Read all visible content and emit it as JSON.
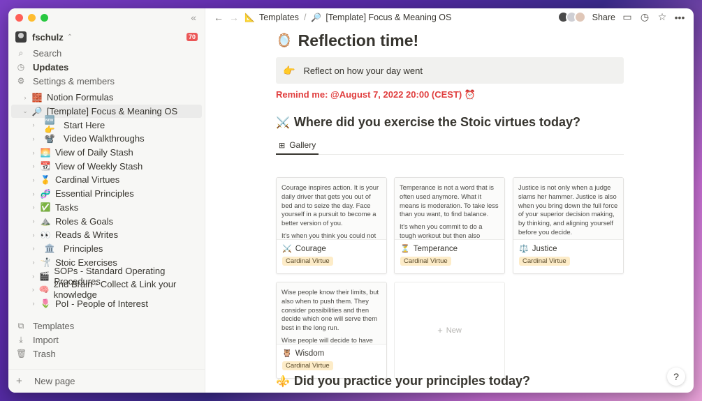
{
  "sidebar": {
    "workspace_name": "fschulz",
    "notification_count": "70",
    "nav": [
      {
        "icon": "search-icon",
        "glyph": "⌕",
        "label": "Search"
      },
      {
        "icon": "clock-icon",
        "glyph": "◷",
        "label": "Updates"
      },
      {
        "icon": "gear-icon",
        "glyph": "⚙",
        "label": "Settings & members"
      }
    ],
    "tree": [
      {
        "label": "Notion Formulas",
        "icon": "🧱",
        "indent": 0
      },
      {
        "label": "[Template] Focus & Meaning OS",
        "icon": "🔎",
        "indent": 0,
        "expanded": true,
        "selected": true
      },
      {
        "label": "Start Here",
        "icon": "🆕👉",
        "indent": 1
      },
      {
        "label": "Video Walkthroughs",
        "icon": "📽️",
        "indent": 1
      },
      {
        "label": "View of Daily Stash",
        "icon": "🌅",
        "indent": 1
      },
      {
        "label": "View of Weekly Stash",
        "icon": "📆",
        "indent": 1
      },
      {
        "label": "Cardinal Virtues",
        "icon": "🥇",
        "indent": 1
      },
      {
        "label": "Essential Principles",
        "icon": "🧬",
        "indent": 1
      },
      {
        "label": "Tasks",
        "icon": "✅",
        "indent": 1
      },
      {
        "label": "Roles & Goals",
        "icon": "⛰️",
        "indent": 1
      },
      {
        "label": "Reads & Writes",
        "icon": "👀",
        "indent": 1
      },
      {
        "label": "Principles",
        "icon": "🏛️",
        "indent": 1
      },
      {
        "label": "Stoic Exercises",
        "icon": "🤺",
        "indent": 1
      },
      {
        "label": "SOPs - Standard Operating Procedures",
        "icon": "🎬",
        "indent": 1
      },
      {
        "label": "2nd Brain - Collect & Link your knowledge",
        "icon": "🧠",
        "indent": 1
      },
      {
        "label": "PoI - People of Interest",
        "icon": "🌷",
        "indent": 1
      }
    ],
    "bottom_nav": [
      {
        "icon": "templates-icon",
        "glyph": "⧉",
        "label": "Templates"
      },
      {
        "icon": "import-icon",
        "glyph": "⤓",
        "label": "Import"
      },
      {
        "icon": "trash-icon",
        "glyph": "🗑",
        "label": "Trash"
      }
    ],
    "new_page": "New page"
  },
  "topbar": {
    "breadcrumb": [
      {
        "icon": "📐",
        "label": "Templates"
      },
      {
        "icon": "🔎",
        "label": "[Template] Focus & Meaning OS"
      }
    ],
    "separator": "/",
    "share_label": "Share",
    "avatar_colors": [
      "#4a4a4a",
      "#cfcfd4",
      "#e0c7b8"
    ]
  },
  "page": {
    "title_emoji": "🪞",
    "title": "Reflection time!",
    "callout_emoji": "👉",
    "callout_text": "Reflect on how your day went",
    "remind_label": "Remind me: ",
    "remind_time": "@August 7, 2022 20:00 (CEST)",
    "remind_emoji": "⏰",
    "section1_emoji": "⚔️",
    "section1_title": "Where did you exercise the Stoic virtues today?",
    "tab_label": "Gallery",
    "section2_emoji": "⚜️",
    "section2_title": "Did you practice your principles today?",
    "new_label": "New"
  },
  "cards": [
    {
      "title": "Courage",
      "emoji": "⚔️",
      "tag": "Cardinal Virtue",
      "p1": "Courage inspires action. It is your daily driver that gets you out of bed and to seize the day. Face yourself in a pursuit to become a better version of you.",
      "p2": "It's when you think you could not"
    },
    {
      "title": "Temperance",
      "emoji": "⏳",
      "tag": "Cardinal Virtue",
      "p1": "Temperance is not a word that is often used anymore. What it means is moderation. To take less than you want, to find balance.",
      "p2": "It's when you commit to do a tough workout but then also commit in the"
    },
    {
      "title": "Justice",
      "emoji": "⚖️",
      "tag": "Cardinal Virtue",
      "p1": "Justice is not only when a judge slams her hammer. Justice is also when you bring down the full force of your superior decision making, by thinking, and aligning yourself before you decide.",
      "p2": ""
    },
    {
      "title": "Wisdom",
      "emoji": "🦉",
      "tag": "Cardinal Virtue",
      "p1": "Wise people know their limits, but also when to push them. They consider possibilities and then decide which one will serve them best in the long run.",
      "p2": "Wise people will decide to have the"
    }
  ],
  "help_label": "?"
}
